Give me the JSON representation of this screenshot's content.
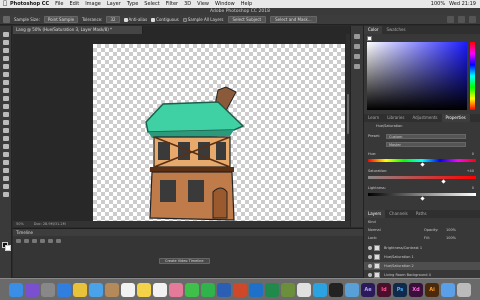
{
  "menubar": {
    "app": "Photoshop CC",
    "items": [
      "File",
      "Edit",
      "Image",
      "Layer",
      "Type",
      "Select",
      "Filter",
      "3D",
      "View",
      "Window",
      "Help"
    ],
    "battery": "100%",
    "clock": "Wed 21:19"
  },
  "window_title": "Adobe Photoshop CC 2018",
  "options": {
    "sample_size_label": "Sample Size:",
    "sample_size_value": "Point Sample",
    "tolerance_label": "Tolerance:",
    "tolerance_value": "32",
    "anti_alias": "Anti-alias",
    "contiguous": "Contiguous",
    "sample_all_layers": "Sample All Layers",
    "select_subject": "Select Subject",
    "select_mask": "Select and Mask..."
  },
  "document": {
    "tab": "Lang @ 50% (Hue/Saturation 3, Layer Mask/8) *",
    "zoom": "50%",
    "doc_size": "Doc: 28.9M/31.2M"
  },
  "timeline": {
    "title": "Timeline",
    "create_button": "Create Video Timeline"
  },
  "color_panel": {
    "tabs": [
      "Color",
      "Swatches"
    ],
    "accent": "#1b1bff"
  },
  "props_panel": {
    "tabs": [
      "Learn",
      "Libraries",
      "Adjustments",
      "Properties"
    ],
    "type_label": "Hue/Saturation",
    "preset_label": "Preset:",
    "preset_value": "Custom",
    "channel_value": "Master",
    "hue_label": "Hue:",
    "hue_value": "0",
    "saturation_label": "Saturation:",
    "saturation_value": "+40",
    "lightness_label": "Lightness:",
    "lightness_value": "0"
  },
  "layers_panel": {
    "tabs": [
      "Layers",
      "Channels",
      "Paths"
    ],
    "kind": "Kind",
    "blend": "Normal",
    "opacity_label": "Opacity:",
    "opacity_value": "100%",
    "lock_label": "Lock:",
    "fill_label": "Fill:",
    "fill_value": "100%",
    "layers": [
      {
        "name": "Brightness/Contrast 1"
      },
      {
        "name": "Hue/Saturation 1"
      },
      {
        "name": "Hue/Saturation 2"
      },
      {
        "name": "Living Room Background 4"
      }
    ]
  },
  "dock": {
    "apps": [
      "Finder",
      "Siri",
      "Launchpad",
      "Safari",
      "Chrome",
      "Mail",
      "Contacts",
      "Calendar",
      "Notes",
      "Reminders",
      "Photos",
      "Messages",
      "FaceTime",
      "Word",
      "PowerPoint",
      "Outlook",
      "Excel",
      "Minecraft",
      "Music",
      "Skype",
      "Terminal",
      "Preview",
      "Ae",
      "Id",
      "Ps",
      "Xd",
      "Illustrator",
      "Folder",
      "Trash"
    ]
  }
}
